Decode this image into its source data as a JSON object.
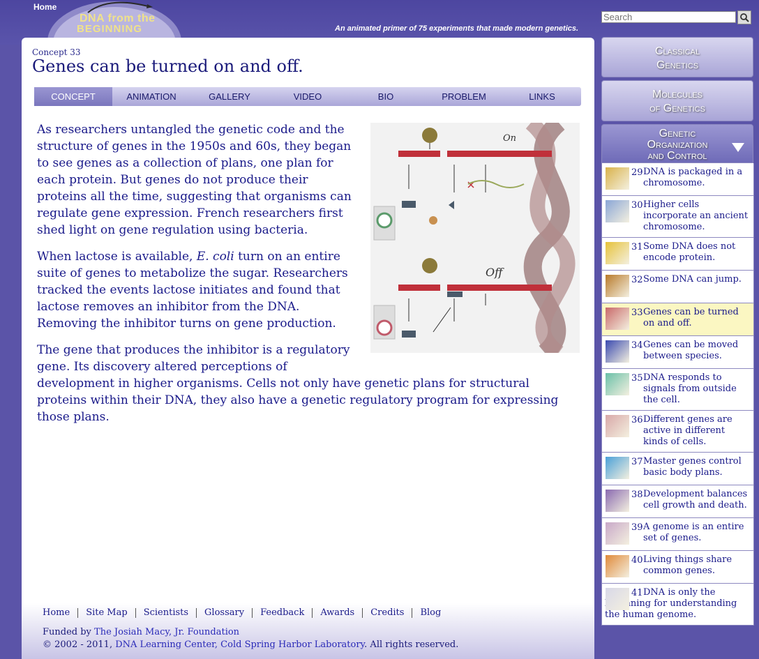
{
  "header": {
    "home_label": "Home",
    "logo_line1": "DNA from the",
    "logo_line2": "BEGINNING",
    "tagline": "An animated primer of 75 experiments that made modern genetics.",
    "search_placeholder": "Search"
  },
  "concept": {
    "number_label": "Concept 33",
    "title": "Genes can be turned on and off."
  },
  "tabs": [
    "CONCEPT",
    "ANIMATION",
    "GALLERY",
    "VIDEO",
    "BIO",
    "PROBLEM",
    "LINKS"
  ],
  "active_tab": "CONCEPT",
  "content": {
    "p1": "As researchers untangled the genetic code and the structure of genes in the 1950s and 60s, they began to see genes as a collection of plans, one plan for each protein. But genes do not produce their proteins all the time, suggesting that organisms can regulate gene expression. French researchers first shed light on gene regulation using bacteria.",
    "p2_a": "When lactose is available, ",
    "p2_em": "E. coli",
    "p2_b": " turn on an entire suite of genes to metabolize the sugar. Researchers tracked the events lactose initiates and found that lactose removes an inhibitor from the DNA. Removing the inhibitor turns on gene production.",
    "p3": "The gene that produces the inhibitor is a regulatory gene. Its discovery altered perceptions of development in higher organisms. Cells not only have genetic plans for structural proteins within their DNA, they also have a genetic regulatory program for expressing those plans.",
    "figure_on_label": "On",
    "figure_off_label": "Off"
  },
  "sidebar": {
    "classical": "Classical Genetics",
    "classical_l1": "Classical",
    "classical_l2": "Genetics",
    "molecules_l1": "Molecules",
    "molecules_l2": "of Genetics",
    "genorg_l1": "Genetic",
    "genorg_l2": "Organization",
    "genorg_l3": "and Control",
    "concepts": [
      {
        "num": "29",
        "text": "DNA is packaged in a chromosome.",
        "color": "#d9b24a"
      },
      {
        "num": "30",
        "text": "Higher cells incorporate an ancient chromosome.",
        "color": "#8aa6d6"
      },
      {
        "num": "31",
        "text": "Some DNA does not encode protein.",
        "color": "#e6c23a"
      },
      {
        "num": "32",
        "text": "Some DNA can jump.",
        "color": "#b87a2a"
      },
      {
        "num": "33",
        "text": "Genes can be turned on and off.",
        "color": "#c96a6a"
      },
      {
        "num": "34",
        "text": "Genes can be moved between species.",
        "color": "#3a4ab0"
      },
      {
        "num": "35",
        "text": "DNA responds to signals from outside the cell.",
        "color": "#6ac0a8"
      },
      {
        "num": "36",
        "text": "Different genes are active in different kinds of cells.",
        "color": "#d8a8a8"
      },
      {
        "num": "37",
        "text": "Master genes control basic body plans.",
        "color": "#4aa0d8"
      },
      {
        "num": "38",
        "text": "Development balances cell growth and death.",
        "color": "#8a6ab0"
      },
      {
        "num": "39",
        "text": "A genome is an entire set of genes.",
        "color": "#c8a8c8"
      },
      {
        "num": "40",
        "text": "Living things share common genes.",
        "color": "#e08a3a"
      },
      {
        "num": "41",
        "text": "DNA is only the beginning for understanding the human genome.",
        "color": "#d8d8e8"
      }
    ],
    "active_num": "33"
  },
  "footer": {
    "links": [
      "Home",
      "Site Map",
      "Scientists",
      "Glossary",
      "Feedback",
      "Awards",
      "Credits",
      "Blog"
    ],
    "funded_prefix": "Funded by ",
    "funded_link": "The Josiah Macy, Jr. Foundation",
    "copyright_prefix": "© 2002 - 2011, ",
    "copyright_link": "DNA Learning Center, Cold Spring Harbor Laboratory",
    "copyright_suffix": ". All rights reserved."
  },
  "colors": {
    "page_bg": "#5b54a8",
    "text": "#1a1a8a",
    "active_item_bg": "#fbf7c2",
    "tab_active": "#8a86c8"
  }
}
